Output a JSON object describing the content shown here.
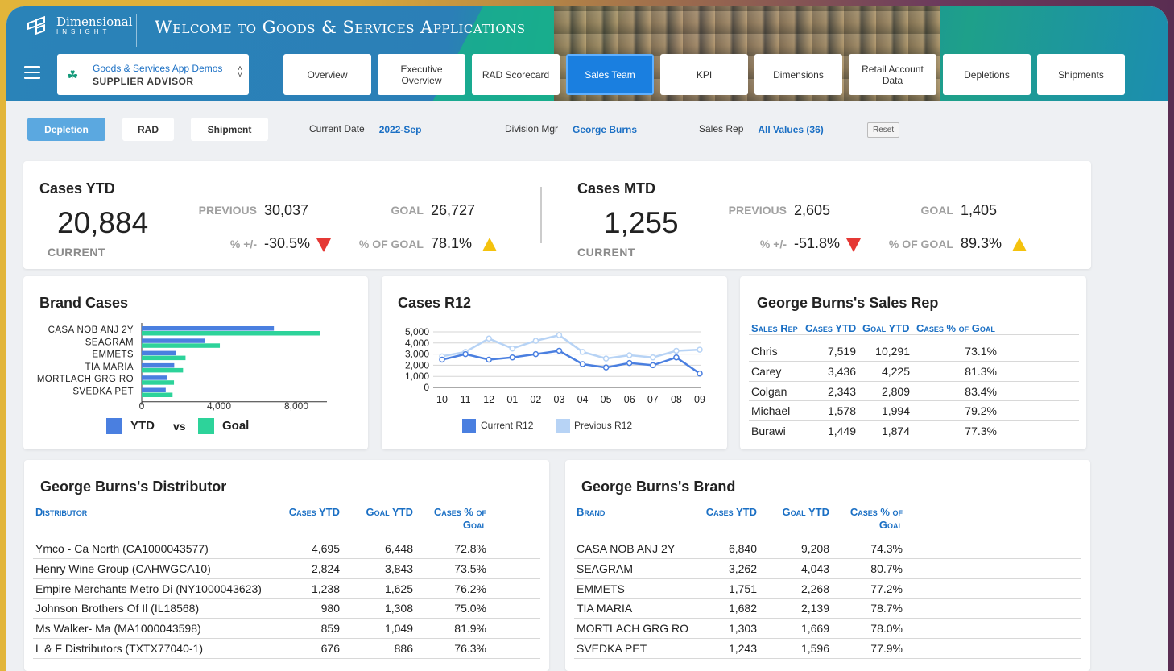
{
  "header": {
    "brand_line1": "Dimensional",
    "brand_line2": "INSIGHT",
    "title": "Welcome to Goods & Services Applications"
  },
  "app_selector": {
    "line1": "Goods & Services App Demos",
    "line2": "SUPPLIER ADVISOR"
  },
  "nav_tabs": [
    {
      "label": "Overview"
    },
    {
      "label": "Executive Overview"
    },
    {
      "label": "RAD Scorecard"
    },
    {
      "label": "Sales Team",
      "active": true
    },
    {
      "label": "KPI"
    },
    {
      "label": "Dimensions"
    },
    {
      "label": "Retail Account Data"
    },
    {
      "label": "Depletions"
    },
    {
      "label": "Shipments"
    }
  ],
  "subnav": {
    "depletion": "Depletion",
    "rad": "RAD",
    "shipment": "Shipment"
  },
  "filters": {
    "date_label": "Current Date",
    "date_value": "2022-Sep",
    "mgr_label": "Division Mgr",
    "mgr_value": "George Burns",
    "rep_label": "Sales Rep",
    "rep_value": "All Values (36)",
    "reset": "Reset"
  },
  "ytd": {
    "title": "Cases YTD",
    "current": "20,884",
    "current_label": "CURRENT",
    "previous_label": "PREVIOUS",
    "previous": "30,037",
    "goal_label": "GOAL",
    "goal": "26,727",
    "pct_label": "% +/-",
    "pct": "-30.5%",
    "pct_goal_label": "% OF GOAL",
    "pct_goal": "78.1%"
  },
  "mtd": {
    "title": "Cases MTD",
    "current": "1,255",
    "current_label": "CURRENT",
    "previous_label": "PREVIOUS",
    "previous": "2,605",
    "goal_label": "GOAL",
    "goal": "1,405",
    "pct_label": "% +/-",
    "pct": "-51.8%",
    "pct_goal_label": "% OF GOAL",
    "pct_goal": "89.3%"
  },
  "brand_cases": {
    "title": "Brand Cases",
    "legend_ytd": "YTD",
    "legend_vs": "vs",
    "legend_goal": "Goal"
  },
  "r12": {
    "title": "Cases R12",
    "legend_current": "Current R12",
    "legend_previous": "Previous R12"
  },
  "chart_data": [
    {
      "type": "bar",
      "orientation": "horizontal",
      "categories": [
        "CASA NOB ANJ 2Y",
        "SEAGRAM",
        "EMMETS",
        "TIA MARIA",
        "MORTLACH GRG RO",
        "SVEDKA PET"
      ],
      "series": [
        {
          "name": "YTD",
          "values": [
            6840,
            3262,
            1751,
            1682,
            1303,
            1243
          ],
          "color": "#4a7fe0"
        },
        {
          "name": "Goal",
          "values": [
            9208,
            4043,
            2268,
            2139,
            1669,
            1596
          ],
          "color": "#2dd39a"
        }
      ],
      "xlim": [
        0,
        10000
      ],
      "xticks": [
        "0",
        "4,000",
        "8,000"
      ],
      "legend": "bottom"
    },
    {
      "type": "line",
      "x": [
        "10",
        "11",
        "12",
        "01",
        "02",
        "03",
        "04",
        "05",
        "06",
        "07",
        "08",
        "09"
      ],
      "series": [
        {
          "name": "Current R12",
          "values": [
            2500,
            3000,
            2500,
            2700,
            3000,
            3300,
            2100,
            1800,
            2200,
            2000,
            2700,
            1255
          ],
          "color": "#4a7fe0"
        },
        {
          "name": "Previous R12",
          "values": [
            2800,
            3200,
            4400,
            3500,
            4200,
            4700,
            3200,
            2600,
            2900,
            2700,
            3300,
            3400
          ],
          "color": "#b7d3f5"
        }
      ],
      "ylim": [
        0,
        5000
      ],
      "yticks": [
        "0",
        "1,000",
        "2,000",
        "3,000",
        "4,000",
        "5,000"
      ],
      "grid": true,
      "legend": "bottom"
    }
  ],
  "sales_rep_table": {
    "title": "George Burns's Sales Rep",
    "headers": [
      "Sales Rep",
      "Cases YTD",
      "Goal YTD",
      "Cases % of Goal"
    ],
    "rows": [
      [
        "Chris",
        "7,519",
        "10,291",
        "73.1%"
      ],
      [
        "Carey",
        "3,436",
        "4,225",
        "81.3%"
      ],
      [
        "Colgan",
        "2,343",
        "2,809",
        "83.4%"
      ],
      [
        "Michael",
        "1,578",
        "1,994",
        "79.2%"
      ],
      [
        "Burawi",
        "1,449",
        "1,874",
        "77.3%"
      ]
    ]
  },
  "distributor_table": {
    "title": "George Burns's Distributor",
    "headers": [
      "Distributor",
      "Cases YTD",
      "Goal YTD",
      "Cases % of",
      "Goal"
    ],
    "rows": [
      [
        "Ymco - Ca North (CA1000043577)",
        "4,695",
        "6,448",
        "72.8%"
      ],
      [
        "Henry Wine Group (CAHWGCA10)",
        "2,824",
        "3,843",
        "73.5%"
      ],
      [
        "Empire Merchants Metro Di (NY1000043623)",
        "1,238",
        "1,625",
        "76.2%"
      ],
      [
        "Johnson Brothers Of Il (IL18568)",
        "980",
        "1,308",
        "75.0%"
      ],
      [
        "Ms Walker- Ma (MA1000043598)",
        "859",
        "1,049",
        "81.9%"
      ],
      [
        "L & F Distributors (TXTX77040-1)",
        "676",
        "886",
        "76.3%"
      ]
    ]
  },
  "brand_table": {
    "title": "George Burns's Brand",
    "headers": [
      "Brand",
      "Cases YTD",
      "Goal YTD",
      "Cases % of",
      "Goal"
    ],
    "rows": [
      [
        "CASA NOB ANJ 2Y",
        "6,840",
        "9,208",
        "74.3%"
      ],
      [
        "SEAGRAM",
        "3,262",
        "4,043",
        "80.7%"
      ],
      [
        "EMMETS",
        "1,751",
        "2,268",
        "77.2%"
      ],
      [
        "TIA MARIA",
        "1,682",
        "2,139",
        "78.7%"
      ],
      [
        "MORTLACH GRG RO",
        "1,303",
        "1,669",
        "78.0%"
      ],
      [
        "SVEDKA PET",
        "1,243",
        "1,596",
        "77.9%"
      ]
    ]
  }
}
